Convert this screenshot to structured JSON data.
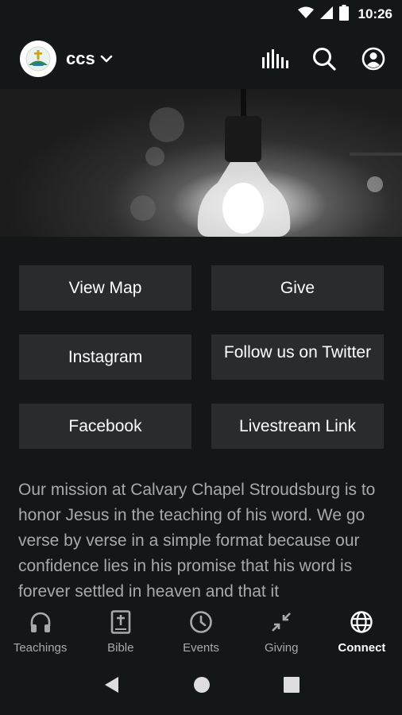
{
  "status_bar": {
    "time": "10:26"
  },
  "app_bar": {
    "org_name": "ccs"
  },
  "buttons": [
    {
      "label": "View Map"
    },
    {
      "label": "Give"
    },
    {
      "label": "Instagram"
    },
    {
      "label": "Follow us on Twitter"
    },
    {
      "label": "Facebook"
    },
    {
      "label": "Livestream Link"
    }
  ],
  "mission": {
    "text": "Our mission at Calvary Chapel Stroudsburg is to honor Jesus in the teaching of his word. We go verse by verse in a simple format because our confidence lies in his promise that his word is forever settled in heaven and that it"
  },
  "tabs": [
    {
      "label": "Teachings",
      "icon": "headphones-icon",
      "active": false
    },
    {
      "label": "Bible",
      "icon": "bible-icon",
      "active": false
    },
    {
      "label": "Events",
      "icon": "clock-icon",
      "active": false
    },
    {
      "label": "Giving",
      "icon": "arrows-in-icon",
      "active": false
    },
    {
      "label": "Connect",
      "icon": "globe-icon",
      "active": true
    }
  ],
  "colors": {
    "background": "#141718",
    "tile": "#2a2b2c",
    "muted_text": "#a8a9aa",
    "active_text": "#ffffff"
  }
}
